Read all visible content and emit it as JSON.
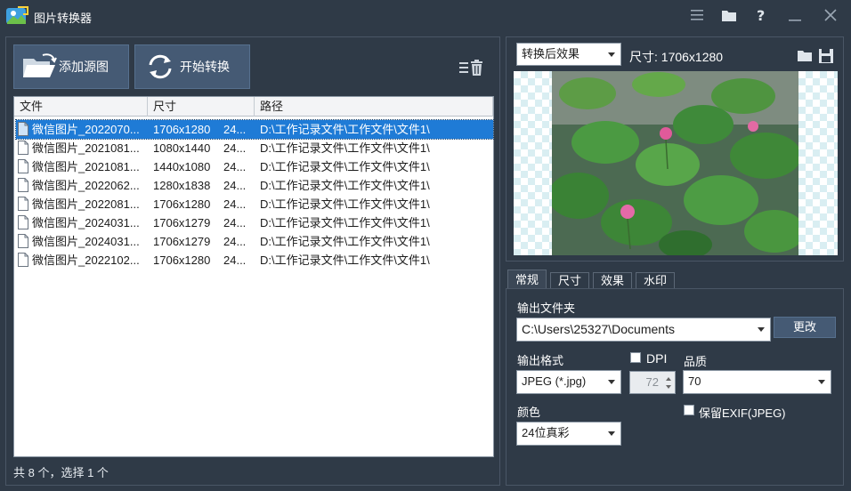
{
  "app": {
    "title": "图片转换器"
  },
  "titlebar_icons": [
    "menu-icon",
    "folder-icon",
    "help-icon",
    "minimize-icon",
    "close-icon"
  ],
  "toolbar": {
    "add_source_label": "添加源图",
    "start_convert_label": "开始转换"
  },
  "file_list": {
    "columns": [
      "文件",
      "尺寸",
      "路径"
    ],
    "rows": [
      {
        "file": "微信图片_2022070...",
        "size": "1706x1280",
        "extra": "24...",
        "path": "D:\\工作记录文件\\工作文件\\文件1\\"
      },
      {
        "file": "微信图片_2021081...",
        "size": "1080x1440",
        "extra": "24...",
        "path": "D:\\工作记录文件\\工作文件\\文件1\\"
      },
      {
        "file": "微信图片_2021081...",
        "size": "1440x1080",
        "extra": "24...",
        "path": "D:\\工作记录文件\\工作文件\\文件1\\"
      },
      {
        "file": "微信图片_2022062...",
        "size": "1280x1838",
        "extra": "24...",
        "path": "D:\\工作记录文件\\工作文件\\文件1\\"
      },
      {
        "file": "微信图片_2022081...",
        "size": "1706x1280",
        "extra": "24...",
        "path": "D:\\工作记录文件\\工作文件\\文件1\\"
      },
      {
        "file": "微信图片_2024031...",
        "size": "1706x1279",
        "extra": "24...",
        "path": "D:\\工作记录文件\\工作文件\\文件1\\"
      },
      {
        "file": "微信图片_2024031...",
        "size": "1706x1279",
        "extra": "24...",
        "path": "D:\\工作记录文件\\工作文件\\文件1\\"
      },
      {
        "file": "微信图片_2022102...",
        "size": "1706x1280",
        "extra": "24...",
        "path": "D:\\工作记录文件\\工作文件\\文件1\\"
      }
    ],
    "selected_index": 0
  },
  "status": {
    "text": "共 8 个，选择 1 个"
  },
  "preview": {
    "mode_selected": "转换后效果",
    "size_text": "尺寸: 1706x1280"
  },
  "tabs": [
    "常规",
    "尺寸",
    "效果",
    "水印"
  ],
  "active_tab": 0,
  "settings": {
    "output_folder_label": "输出文件夹",
    "output_folder_value": "C:\\Users\\25327\\Documents",
    "change_button": "更改",
    "output_format_label": "输出格式",
    "output_format_value": "JPEG (*.jpg)",
    "dpi_label": "DPI",
    "dpi_checked": false,
    "dpi_value": "72",
    "quality_label": "品质",
    "quality_value": "70",
    "color_label": "颜色",
    "color_value": "24位真彩",
    "keep_exif_label": "保留EXIF(JPEG)",
    "keep_exif_checked": false
  },
  "colors": {
    "background": "#2f3a47",
    "button": "#455a74",
    "selection": "#1f7bd6"
  }
}
